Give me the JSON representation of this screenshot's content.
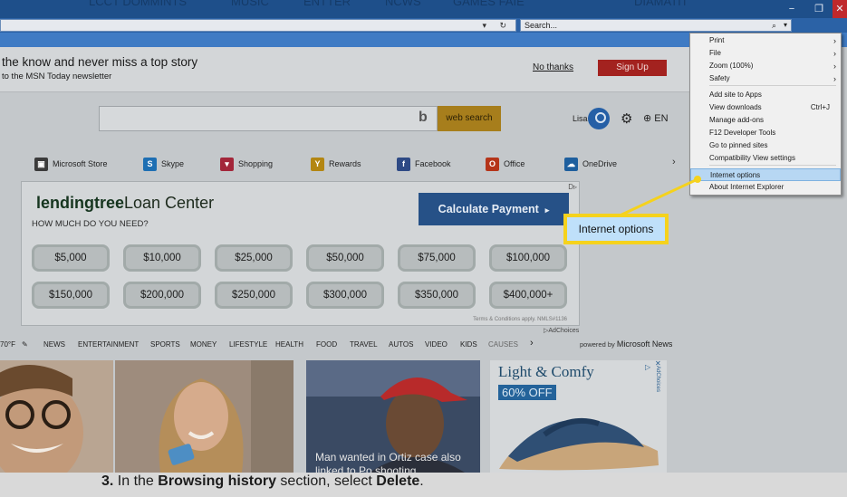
{
  "browser": {
    "ghost_tabs": [
      "LCCT DOMMINTS",
      "MUSIC",
      "ENTTER",
      "NCWS",
      "GAMES FAIE",
      "DIAMATIT",
      "DOMMINTS"
    ],
    "window_controls": [
      "−",
      "❐",
      "✕"
    ],
    "address_controls": "▾ ↻",
    "search_placeholder": "Search...",
    "toolbar_icons": [
      "home-icon",
      "favorites-star-icon",
      "settings-gear-icon"
    ]
  },
  "banner": {
    "headline": "the know and never miss a top story",
    "subline": "to the MSN Today newsletter",
    "no_thanks": "No thanks",
    "sign_up": "Sign Up"
  },
  "search": {
    "bing_glyph": "b",
    "button": "web search",
    "user_name": "Lisa",
    "gear": "⚙",
    "language": "⊕ EN"
  },
  "quicklinks": [
    {
      "label": "Microsoft Store",
      "icon": "store-bag-icon",
      "glyph": "▣",
      "color": "#3b3b3b"
    },
    {
      "label": "Skype",
      "icon": "skype-icon",
      "glyph": "S",
      "color": "#1e6fb3"
    },
    {
      "label": "Shopping",
      "icon": "shopping-bag-icon",
      "glyph": "▾",
      "color": "#a3263a"
    },
    {
      "label": "Rewards",
      "icon": "rewards-trophy-icon",
      "glyph": "Y",
      "color": "#b38612"
    },
    {
      "label": "Facebook",
      "icon": "facebook-icon",
      "glyph": "f",
      "color": "#2e4a85"
    },
    {
      "label": "Office",
      "icon": "office-icon",
      "glyph": "O",
      "color": "#b5351a"
    },
    {
      "label": "OneDrive",
      "icon": "onedrive-cloud-icon",
      "glyph": "☁",
      "color": "#1e5f9e"
    }
  ],
  "quicklinks_next": "›",
  "ad": {
    "logo_bold": "lendingtree",
    "logo_rest": "Loan Center",
    "question": "HOW MUCH DO YOU NEED?",
    "cta": "Calculate Payment",
    "cta_arrow": "▸",
    "close_mark": "D▹",
    "amounts": [
      "$5,000",
      "$10,000",
      "$25,000",
      "$50,000",
      "$75,000",
      "$100,000",
      "$150,000",
      "$200,000",
      "$250,000",
      "$300,000",
      "$350,000",
      "$400,000+"
    ],
    "terms": "Terms & Conditions apply. NMLS#1136",
    "adchoices": "▷AdChoices"
  },
  "newsnav": {
    "weather": "70°F",
    "pencil": "✎",
    "items": [
      "NEWS",
      "ENTERTAINMENT",
      "SPORTS",
      "MONEY",
      "LIFESTYLE",
      "HEALTH",
      "FOOD",
      "TRAVEL",
      "AUTOS",
      "VIDEO",
      "KIDS",
      "CAUSES"
    ],
    "more": "›",
    "powered_prefix": "powered by",
    "powered_brand": "Microsoft News"
  },
  "tiles": {
    "news_caption": "Man wanted in Ortiz case also linked to Po shooting",
    "ad_title": "Light & Comfy",
    "ad_offer": "60% OFF",
    "ad_tri": "▷",
    "ad_choices": "AdChoices",
    "ad_x": "✕"
  },
  "menu": {
    "items": [
      {
        "label": "Print",
        "arrow": "›",
        "shortcut": ""
      },
      {
        "label": "File",
        "arrow": "›",
        "shortcut": ""
      },
      {
        "label": "Zoom (100%)",
        "arrow": "›",
        "shortcut": ""
      },
      {
        "label": "Safety",
        "arrow": "›",
        "shortcut": ""
      },
      {
        "label": "Add site to Apps",
        "arrow": "",
        "shortcut": ""
      },
      {
        "label": "View downloads",
        "arrow": "",
        "shortcut": "Ctrl+J"
      },
      {
        "label": "Manage add-ons",
        "arrow": "",
        "shortcut": ""
      },
      {
        "label": "F12 Developer Tools",
        "arrow": "",
        "shortcut": ""
      },
      {
        "label": "Go to pinned sites",
        "arrow": "",
        "shortcut": ""
      },
      {
        "label": "Compatibility View settings",
        "arrow": "",
        "shortcut": ""
      },
      {
        "label": "Internet options",
        "arrow": "",
        "shortcut": ""
      },
      {
        "label": "About Internet Explorer",
        "arrow": "",
        "shortcut": ""
      }
    ],
    "highlighted": "Internet options"
  },
  "callout": {
    "label": "Internet options",
    "color": "#f5d21d"
  },
  "instruction": {
    "number": "3.",
    "pre": "In the",
    "section": "Browsing history",
    "mid": "section, select",
    "action": "Delete",
    "end": "."
  },
  "colors": {
    "accent": "#f5d21d",
    "highlight": "#b7d7f3",
    "chrome": "#2b62a6"
  }
}
